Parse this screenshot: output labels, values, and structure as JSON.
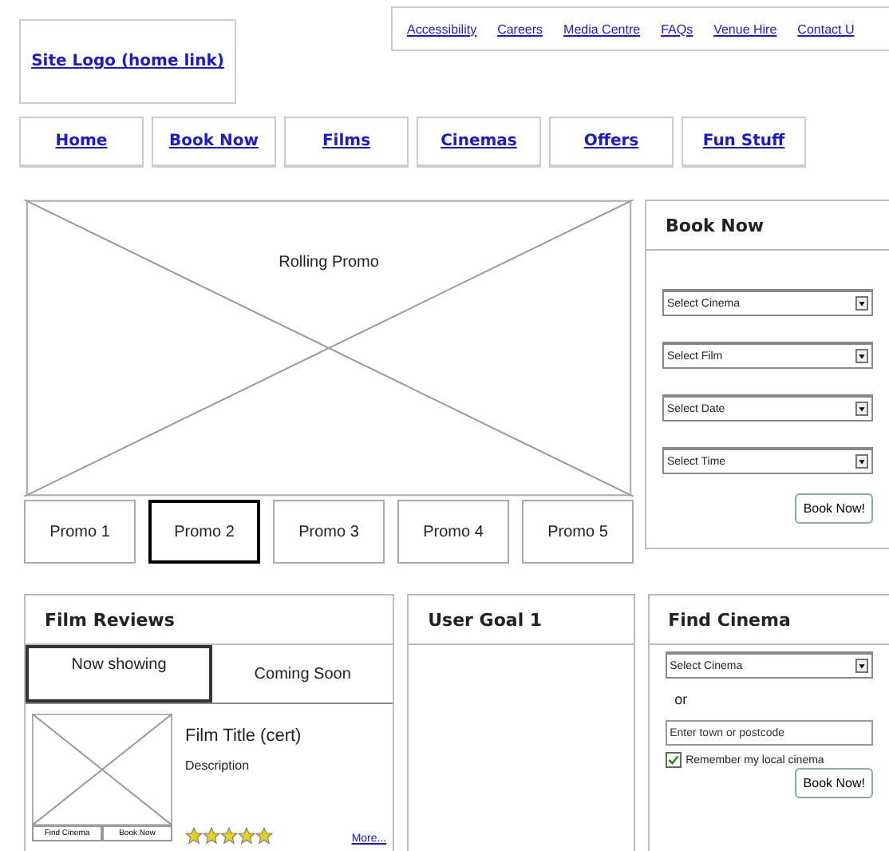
{
  "logo": {
    "label": "Site Logo (home link)"
  },
  "utility_links": [
    "Accessibility",
    "Careers",
    "Media Centre",
    "FAQs",
    "Venue Hire",
    "Contact U"
  ],
  "nav": [
    "Home",
    "Book Now",
    "Films",
    "Cinemas",
    "Offers",
    "Fun Stuff"
  ],
  "promo": {
    "label": "Rolling Promo",
    "tabs": [
      {
        "label": "Promo 1",
        "selected": false
      },
      {
        "label": "Promo 2",
        "selected": true
      },
      {
        "label": "Promo 3",
        "selected": false
      },
      {
        "label": "Promo 4",
        "selected": false
      },
      {
        "label": "Promo 5",
        "selected": false
      }
    ]
  },
  "book_now": {
    "title": "Book Now",
    "selects": [
      "Select Cinema",
      "Select Film",
      "Select Date",
      "Select Time"
    ],
    "button": "Book Now!"
  },
  "film_reviews": {
    "title": "Film Reviews",
    "tabs": [
      {
        "label": "Now showing",
        "selected": true
      },
      {
        "label": "Coming Soon",
        "selected": false
      }
    ],
    "film": {
      "title": "Film Title (cert)",
      "description": "Description",
      "buttons": [
        "Find Cinema",
        "Book Now"
      ],
      "stars": 5,
      "more": "More..."
    }
  },
  "user_goal": {
    "title": "User Goal 1"
  },
  "find_cinema": {
    "title": "Find Cinema",
    "select": "Select Cinema",
    "or": "or",
    "placeholder": "Enter town or postcode",
    "remember": {
      "label": "Remember my local cinema",
      "checked": true
    },
    "button": "Book Now!"
  }
}
